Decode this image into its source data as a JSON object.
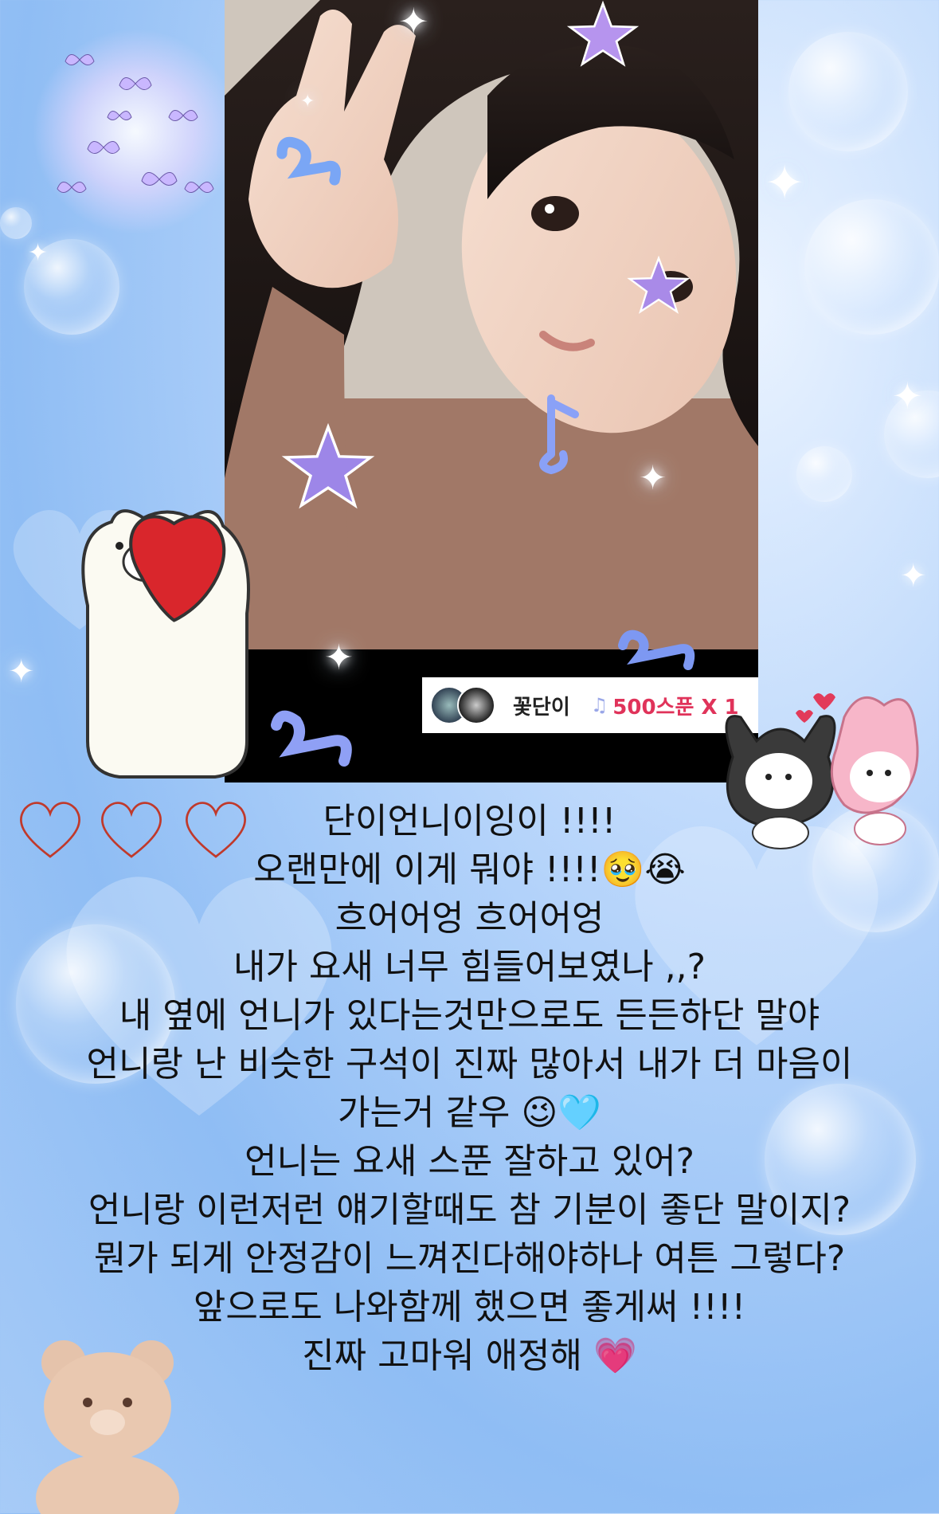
{
  "gift_bar": {
    "username": "꽃단이",
    "gift_label": "500스푼 X 1"
  },
  "message_lines": [
    "단이언니이잉이 !!!!",
    "오랜만에 이게 뭐야 !!!!🥹😭",
    "흐어어엉 흐어어엉",
    "내가 요새 너무 힘들어보였나 ,,?",
    "내 옆에 언니가 있다는것만으로도 든든하단 말야",
    "언니랑 난 비슷한 구석이 진짜 많아서 내가 더 마음이",
    "가는거 같우 😉🩵",
    "언니는 요새 스푼 잘하고 있어?",
    "언니랑 이런저런 얘기할때도 참 기분이 좋단 말이지?",
    "뭔가 되게 안정감이 느껴진다해야하나 여튼 그렇다?",
    "앞으로도 나와함께 했으면 좋게써 !!!!",
    "진짜 고마워 애정해 💗"
  ],
  "colors": {
    "accent_gift": "#e0335a",
    "background": "#a9cdf7",
    "heart_outline": "#c0392b"
  },
  "icons": [
    "butterfly-cluster-icon",
    "star-sticker-icon",
    "music-note-sticker-icon",
    "polar-bear-heart-sticker",
    "kuromi-mymelody-sticker",
    "teddy-bear-sticker",
    "outline-heart-icon",
    "sparkle-icon"
  ]
}
